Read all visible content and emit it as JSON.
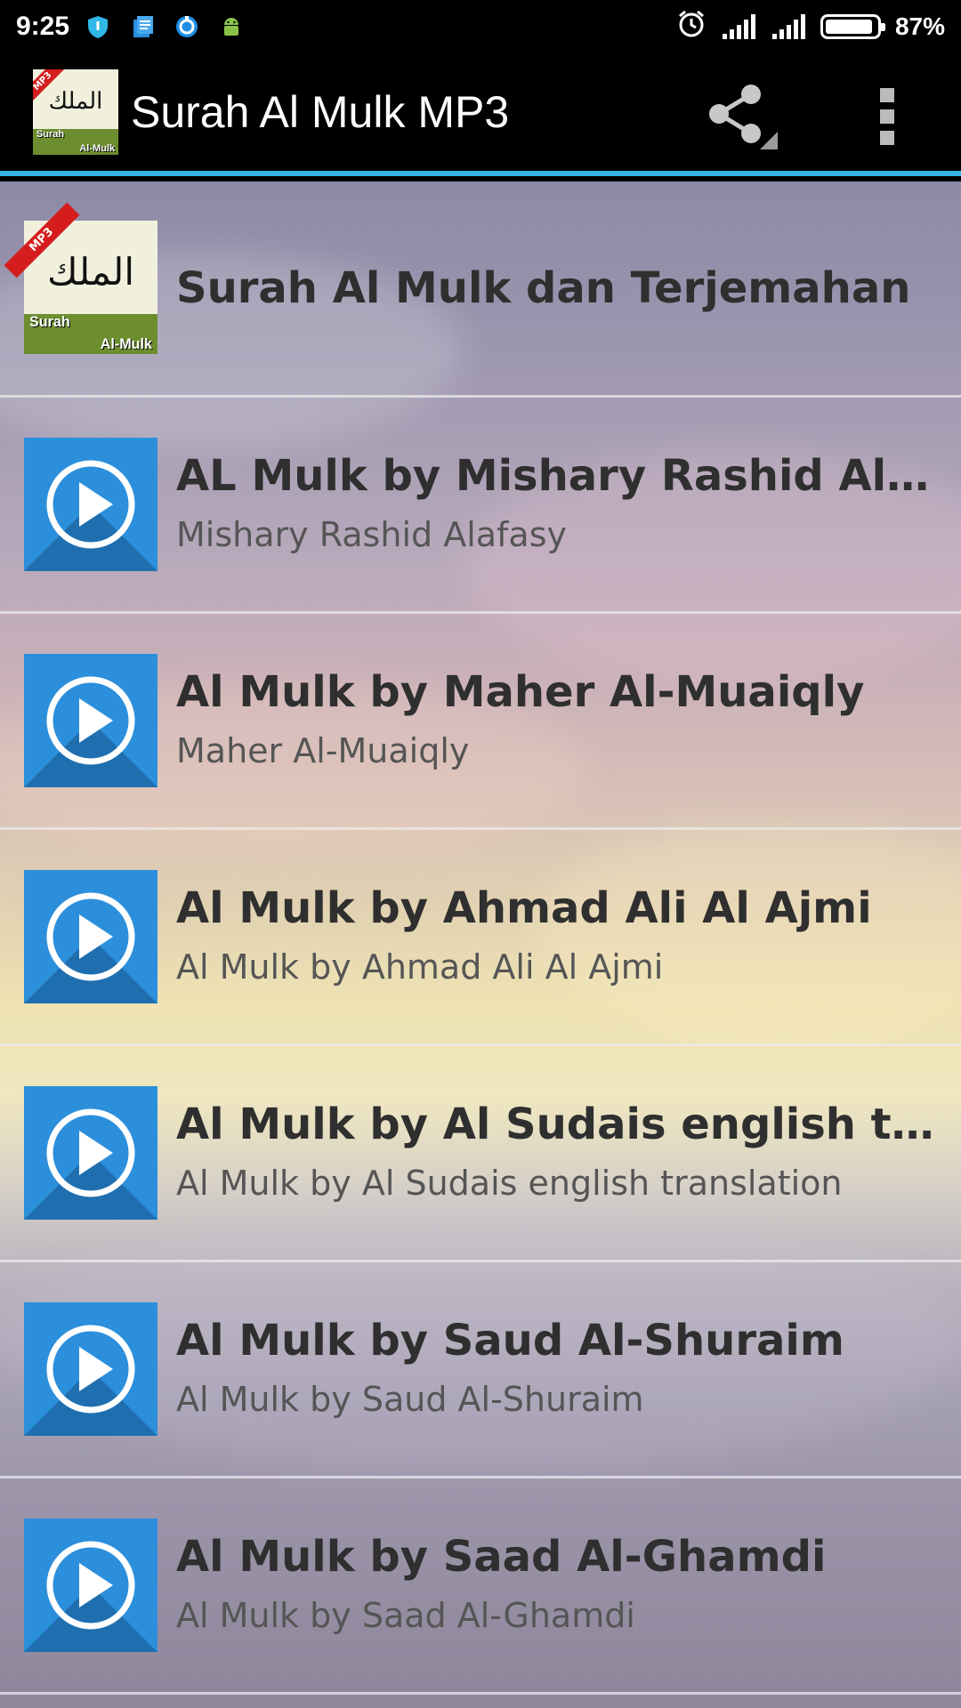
{
  "status_bar": {
    "time": "9:25",
    "battery_text": "87%",
    "battery_level": 0.87
  },
  "action_bar": {
    "title": "Surah Al Mulk MP3",
    "logo": {
      "badge": "MP3",
      "arabic": "الملك",
      "line1": "Surah",
      "line2": "Al-Mulk"
    }
  },
  "list": [
    {
      "title": "Surah Al Mulk dan Terjemahan",
      "subtitle": "",
      "icon": "app-logo"
    },
    {
      "title": "AL Mulk by Mishary Rashid Alafasy",
      "subtitle": "Mishary Rashid Alafasy",
      "icon": "play-icon"
    },
    {
      "title": "Al Mulk by Maher Al-Muaiqly",
      "subtitle": "Maher Al-Muaiqly",
      "icon": "play-icon"
    },
    {
      "title": "Al Mulk by Ahmad Ali Al Ajmi",
      "subtitle": "Al Mulk by Ahmad Ali Al Ajmi",
      "icon": "play-icon"
    },
    {
      "title": "Al Mulk by Al Sudais english tran...",
      "subtitle": "Al Mulk by Al Sudais english translation",
      "icon": "play-icon"
    },
    {
      "title": "Al Mulk by Saud Al-Shuraim",
      "subtitle": "Al Mulk by Saud Al-Shuraim",
      "icon": "play-icon"
    },
    {
      "title": "Al Mulk by Saad Al-Ghamdi",
      "subtitle": "Al Mulk by Saad Al-Ghamdi",
      "icon": "play-icon"
    }
  ],
  "colors": {
    "accent": "#33b5e5",
    "play_blue": "#2c8fdc",
    "play_shadow": "#1f6fb0"
  }
}
